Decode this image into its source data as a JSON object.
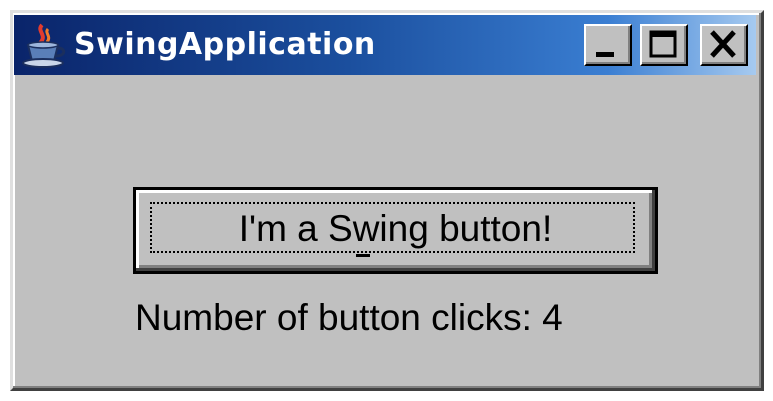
{
  "window": {
    "title": "SwingApplication",
    "title_bar_color": "#0a246a",
    "title_bar_gradient_end": "#a6caf0",
    "background_color": "#c0c0c0",
    "app_icon": "java-coffee-cup-icon",
    "controls": {
      "minimize_icon": "minimize-icon",
      "maximize_icon": "maximize-icon",
      "close_icon": "close-icon"
    }
  },
  "content": {
    "button_label": "I'm a Swing button!",
    "button_mnemonic": "I",
    "clicks_text": "Number of button clicks: 4"
  }
}
